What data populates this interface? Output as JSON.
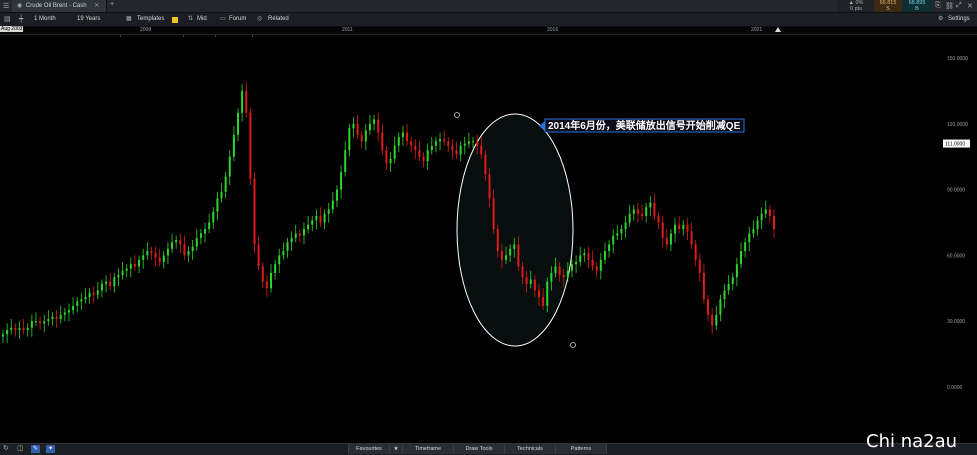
{
  "tabbar": {
    "menu_icon": "hamburger-icon",
    "instrument_tab": "Crude Oil Brent - Cash",
    "change_pct": "▲ 0%",
    "change_pts": "0 pts",
    "sell_price": "66.815",
    "sell_label": "S",
    "buy_price": "68.895",
    "buy_label": "B"
  },
  "toolbar": {
    "interval": "1 Month",
    "range": "19 Years",
    "templates": "Templates",
    "price_type": "Mid",
    "forum": "Forum",
    "related": "Related",
    "settings": "Settings"
  },
  "date_axis": {
    "start_label": "Aug 2003",
    "years": [
      "2008",
      "2011",
      "2016",
      "2021"
    ]
  },
  "price_axis": {
    "labels": [
      "150.0000",
      "120.0000",
      "90.0000",
      "60.0000",
      "30.0000",
      "0.0000"
    ],
    "current": "111.0000"
  },
  "annotation": {
    "text": "2014年6月份，美联储放出信号开始削减QE"
  },
  "bottom_bar": {
    "favourites": "Favourites",
    "timeframe": "Timeframe",
    "draw_tools": "Draw Tools",
    "technicals": "Technicals",
    "patterns": "Patterns"
  },
  "watermark": "Chi na2au",
  "colors": {
    "up": "#2fd52f",
    "down": "#e01b1b",
    "annotation_bg": "#0c0c1a",
    "annotation_border": "#2a6fdc",
    "sell_bg": "#3d2a12",
    "buy_bg": "#0f2e33"
  },
  "chart_data": {
    "type": "candlestick",
    "x_start": "2003-08",
    "interval": "1 Month",
    "ylim": [
      -5,
      157
    ],
    "y_ticks": [
      0,
      30,
      60,
      90,
      120,
      150
    ],
    "closes": [
      24,
      26,
      27,
      26,
      27,
      26,
      27,
      30,
      30,
      29,
      30,
      31,
      32,
      31,
      33,
      34,
      35,
      37,
      39,
      40,
      41,
      43,
      42,
      44,
      47,
      48,
      46,
      50,
      51,
      53,
      54,
      56,
      55,
      58,
      60,
      62,
      61,
      59,
      57,
      60,
      63,
      66,
      67,
      65,
      60,
      62,
      64,
      68,
      70,
      72,
      75,
      80,
      86,
      89,
      96,
      105,
      115,
      125,
      135,
      125,
      95,
      65,
      55,
      48,
      45,
      52,
      56,
      60,
      62,
      66,
      68,
      70,
      69,
      72,
      74,
      76,
      78,
      75,
      79,
      81,
      85,
      90,
      98,
      108,
      118,
      120,
      115,
      112,
      117,
      120,
      122,
      116,
      108,
      102,
      104,
      110,
      114,
      116,
      112,
      110,
      108,
      105,
      103,
      108,
      110,
      112,
      113,
      112,
      110,
      108,
      106,
      110,
      111,
      112,
      112,
      110,
      106,
      97,
      86,
      72,
      62,
      58,
      60,
      63,
      65,
      55,
      50,
      47,
      49,
      44,
      41,
      37,
      48,
      52,
      55,
      51,
      50,
      53,
      56,
      57,
      60,
      61,
      58,
      55,
      53,
      58,
      62,
      65,
      69,
      70,
      72,
      75,
      79,
      81,
      79,
      78,
      82,
      84,
      78,
      75,
      68,
      65,
      70,
      74,
      72,
      74,
      71,
      65,
      58,
      52,
      40,
      33,
      28,
      33,
      40,
      44,
      47,
      50,
      56,
      62,
      66,
      70,
      72,
      76,
      79,
      81,
      78,
      72
    ]
  }
}
